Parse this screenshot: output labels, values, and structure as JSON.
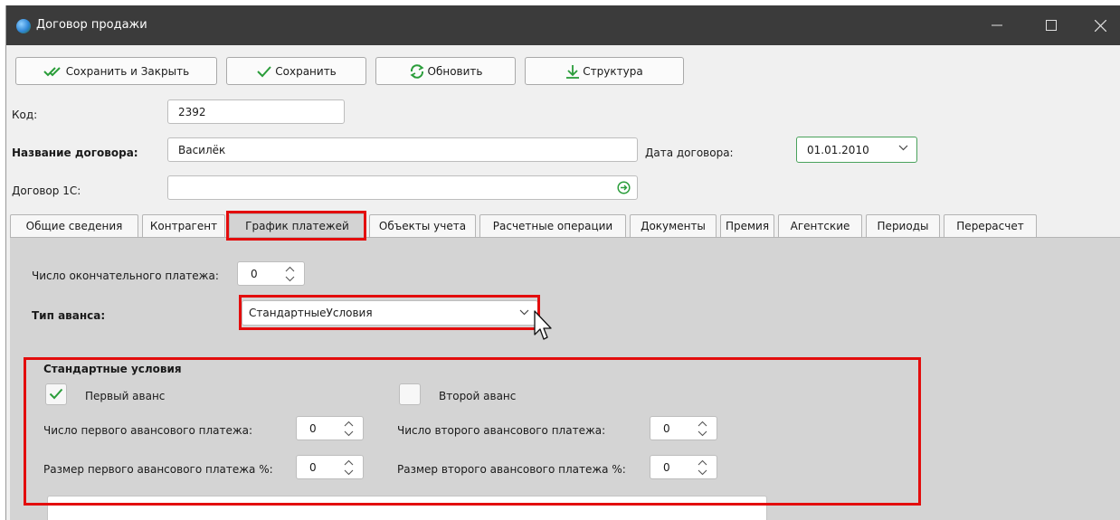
{
  "window": {
    "title": "Договор продажи"
  },
  "toolbar": {
    "save_close_label": "Сохранить и Закрыть",
    "save_label": "Сохранить",
    "refresh_label": "Обновить",
    "structure_label": "Структура"
  },
  "form": {
    "code_label": "Код:",
    "code_value": "2392",
    "contract_name_label": "Название договора:",
    "contract_name_value": "Василёк",
    "contract_date_label": "Дата договора:",
    "contract_date_value": "01.01.2010",
    "contract_1c_label": "Договор 1С:",
    "contract_1c_value": ""
  },
  "tabs": [
    {
      "label": "Общие сведения"
    },
    {
      "label": "Контрагент"
    },
    {
      "label": "График платежей",
      "active": true
    },
    {
      "label": "Объекты учета"
    },
    {
      "label": "Расчетные операции"
    },
    {
      "label": "Документы"
    },
    {
      "label": "Премия"
    },
    {
      "label": "Агентские"
    },
    {
      "label": "Периоды"
    },
    {
      "label": "Перерасчет"
    }
  ],
  "payments": {
    "final_count_label": "Число окончательного платежа:",
    "final_count_value": "0",
    "advance_type_label": "Тип аванса:",
    "advance_type_value": "СтандартныеУсловия",
    "standard_title": "Стандартные условия",
    "first_advance_label": "Первый аванс",
    "first_advance_checked": true,
    "second_advance_label": "Второй аванс",
    "second_advance_checked": false,
    "first_count_label": "Число первого авансового платежа:",
    "first_count_value": "0",
    "second_count_label": "Число второго авансового платежа:",
    "second_count_value": "0",
    "first_size_label": "Размер первого авансового платежа %:",
    "first_size_value": "0",
    "second_size_label": "Размер второго авансового платежа %:",
    "second_size_value": "0"
  },
  "icons": {
    "save_close": "double-check-icon",
    "save": "check-icon",
    "refresh": "refresh-icon",
    "structure": "download-arrow-icon",
    "go": "arrow-circle-icon"
  },
  "colors": {
    "titlebar": "#3b3b3b",
    "accent_green": "#2a9d3a",
    "highlight_red": "#e30d0d",
    "panel": "#d4d4d4"
  }
}
